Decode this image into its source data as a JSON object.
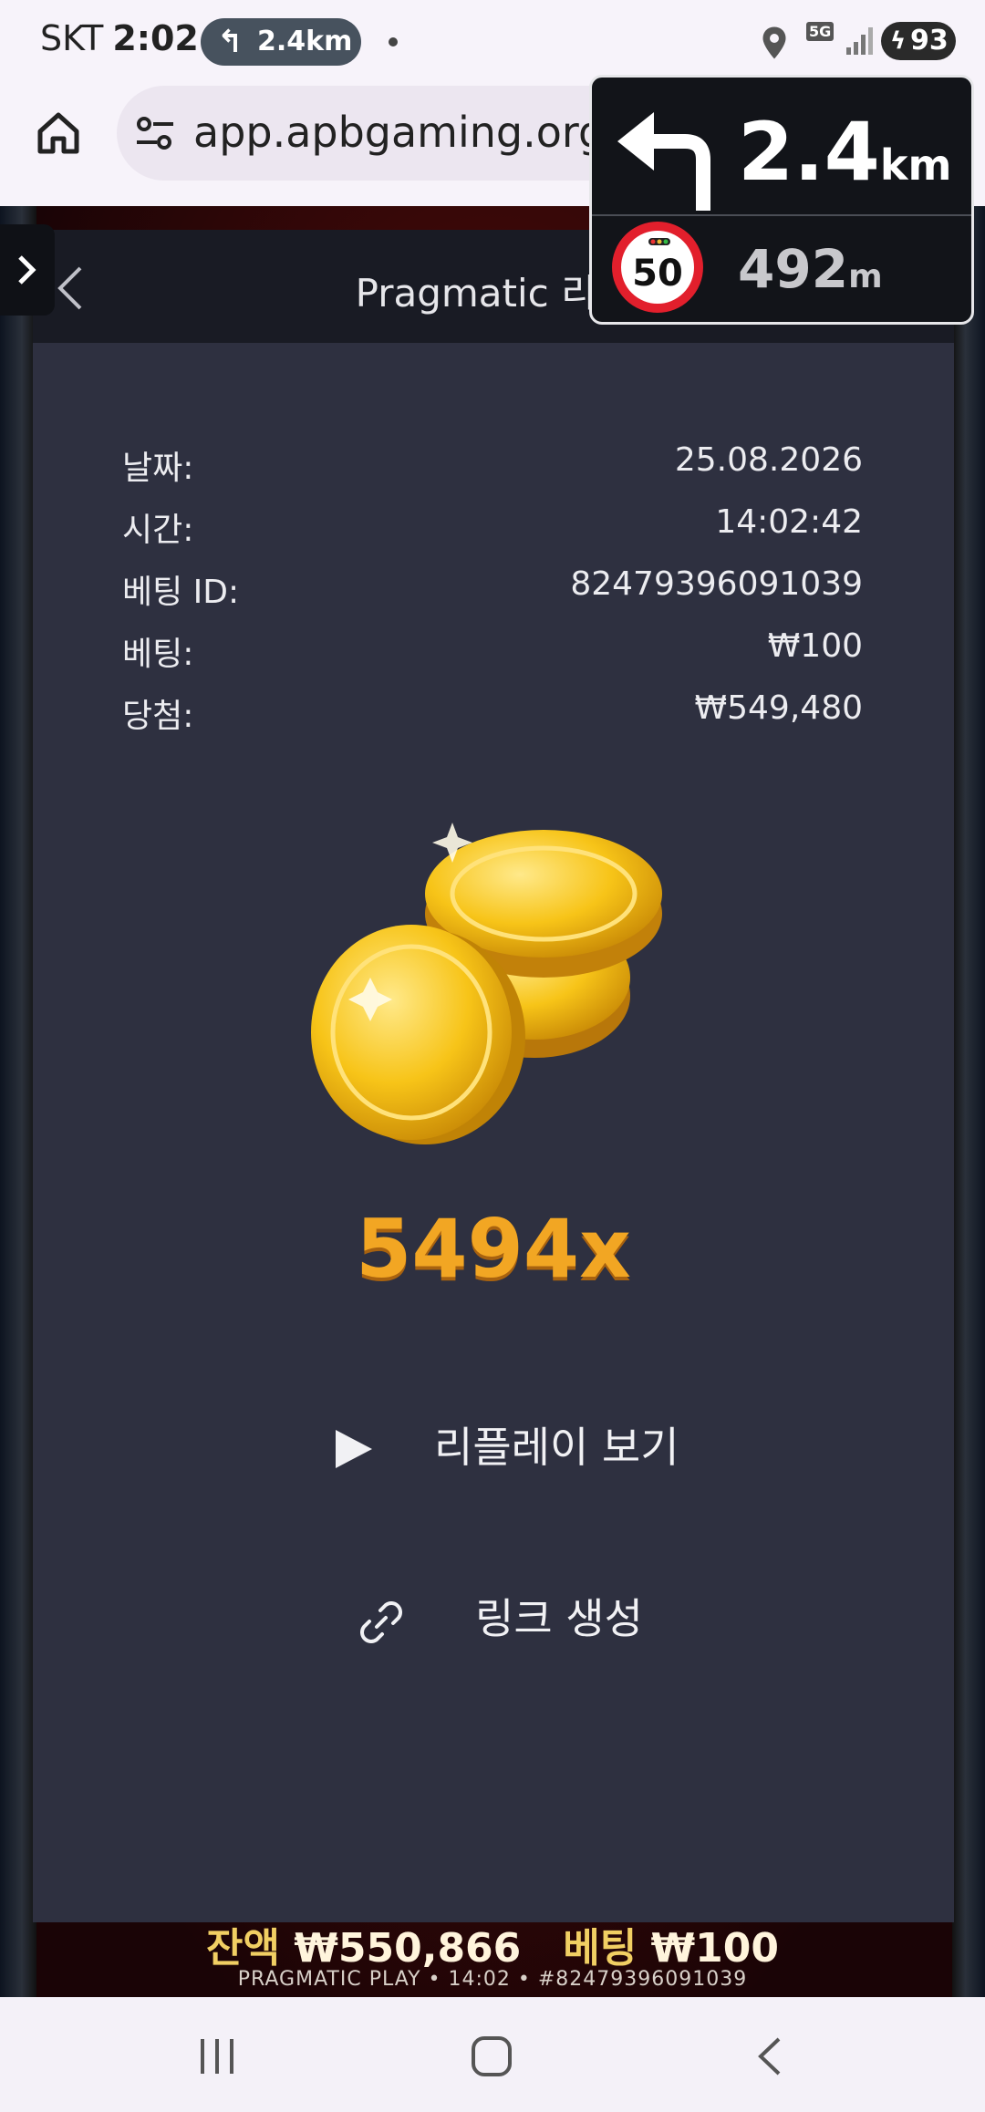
{
  "status_bar": {
    "carrier": "SKT",
    "time": "2:02",
    "nav_pill_distance": "2.4km",
    "network": "5G",
    "battery": "93"
  },
  "browser": {
    "url": "app.apbgaming.org/c"
  },
  "replay_dialog": {
    "title": "Pragmatic 리플",
    "info": {
      "date_label": "날짜:",
      "date_value": "25.08.2026",
      "time_label": "시간:",
      "time_value": "14:02:42",
      "bet_id_label": "베팅 ID:",
      "bet_id_value": "82479396091039",
      "bet_label": "베팅:",
      "bet_value": "₩100",
      "win_label": "당첨:",
      "win_value": "₩549,480"
    },
    "multiplier": "5494x",
    "replay_button": "리플레이 보기",
    "link_button": "링크 생성"
  },
  "game_footer": {
    "balance_label": "잔액",
    "balance_value": "₩550,866",
    "bet_label": "베팅",
    "bet_value": "₩100",
    "meta": "PRAGMATIC PLAY • 14:02 • #82479396091039"
  },
  "navigation_overlay": {
    "turn_distance": "2.4",
    "turn_unit": "km",
    "speed_limit": "50",
    "next_distance": "492",
    "next_unit": "m"
  },
  "colors": {
    "dialog_bg": "#2e3040",
    "dialog_header_bg": "#191b24",
    "multiplier_gold": "#f2a623",
    "speed_sign_red": "#e21f2c"
  }
}
